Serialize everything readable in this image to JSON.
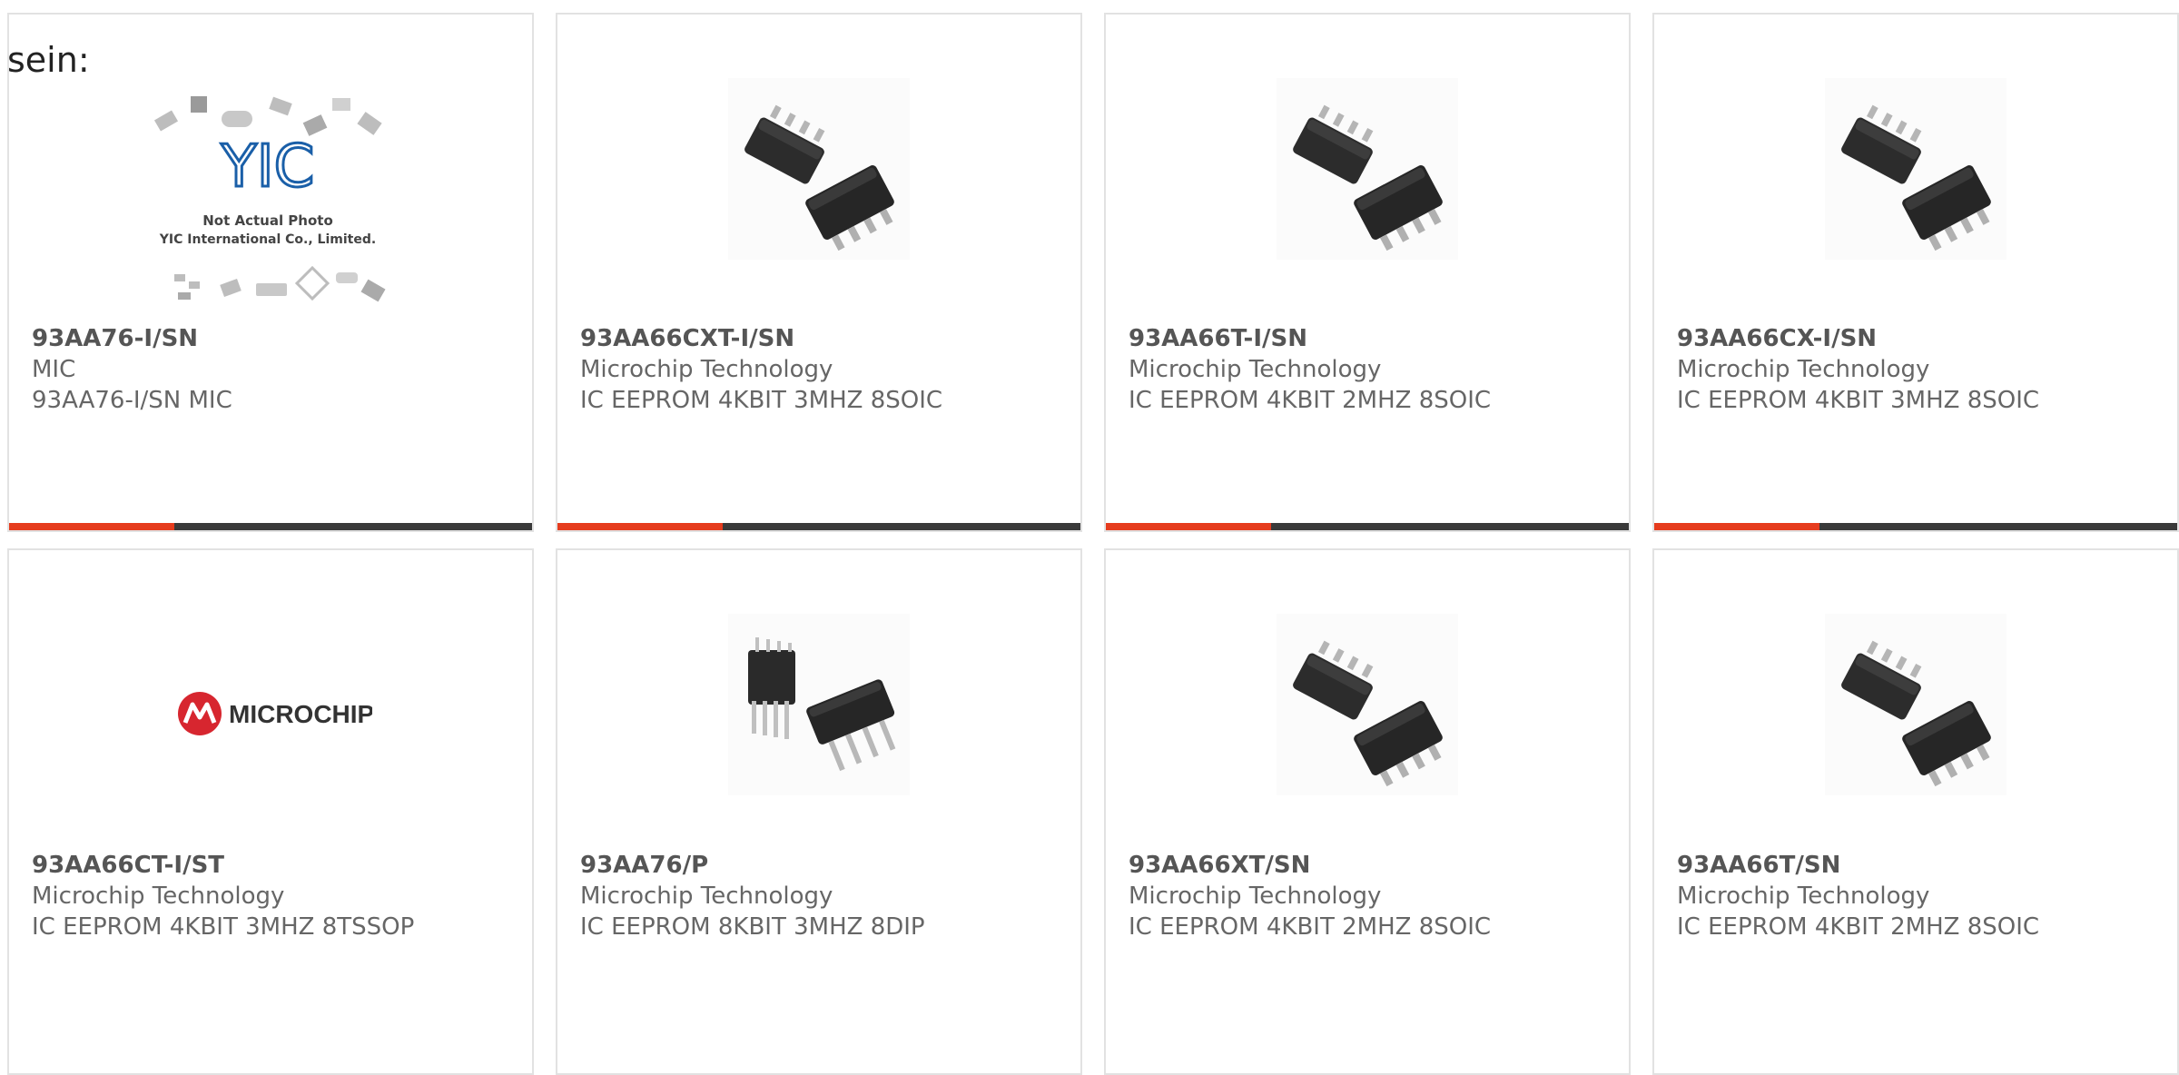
{
  "intro_text": "sein:",
  "colors": {
    "accent": "#e63c1e",
    "bar_dark": "#3a3a3a",
    "border": "#e2e2e2",
    "title_text": "#555555",
    "body_text": "#666666",
    "yic_blue": "#1a5fa8",
    "microchip_red": "#d7262f"
  },
  "products": [
    {
      "part_number": "93AA76-I/SN",
      "manufacturer": "MIC",
      "description": "93AA76-I/SN MIC",
      "image": "yic-placeholder-photo",
      "image_caption_1": "Not Actual Photo",
      "image_caption_2": "YIC International Co., Limited.",
      "image_brand": "YIC"
    },
    {
      "part_number": "93AA66CXT-I/SN",
      "manufacturer": "Microchip Technology",
      "description": "IC EEPROM 4KBIT 3MHZ 8SOIC",
      "image": "soic-8-chip-photo"
    },
    {
      "part_number": "93AA66T-I/SN",
      "manufacturer": "Microchip Technology",
      "description": "IC EEPROM 4KBIT 2MHZ 8SOIC",
      "image": "soic-8-chip-photo"
    },
    {
      "part_number": "93AA66CX-I/SN",
      "manufacturer": "Microchip Technology",
      "description": "IC EEPROM 4KBIT 3MHZ 8SOIC",
      "image": "soic-8-chip-photo"
    },
    {
      "part_number": "93AA66CT-I/ST",
      "manufacturer": "Microchip Technology",
      "description": "IC EEPROM 4KBIT 3MHZ 8TSSOP",
      "image": "microchip-logo",
      "image_brand": "MICROCHIP"
    },
    {
      "part_number": "93AA76/P",
      "manufacturer": "Microchip Technology",
      "description": "IC EEPROM 8KBIT 3MHZ 8DIP",
      "image": "dip-8-chip-photo"
    },
    {
      "part_number": "93AA66XT/SN",
      "manufacturer": "Microchip Technology",
      "description": "IC EEPROM 4KBIT 2MHZ 8SOIC",
      "image": "soic-8-chip-photo"
    },
    {
      "part_number": "93AA66T/SN",
      "manufacturer": "Microchip Technology",
      "description": "IC EEPROM 4KBIT 2MHZ 8SOIC",
      "image": "soic-8-chip-photo"
    }
  ]
}
